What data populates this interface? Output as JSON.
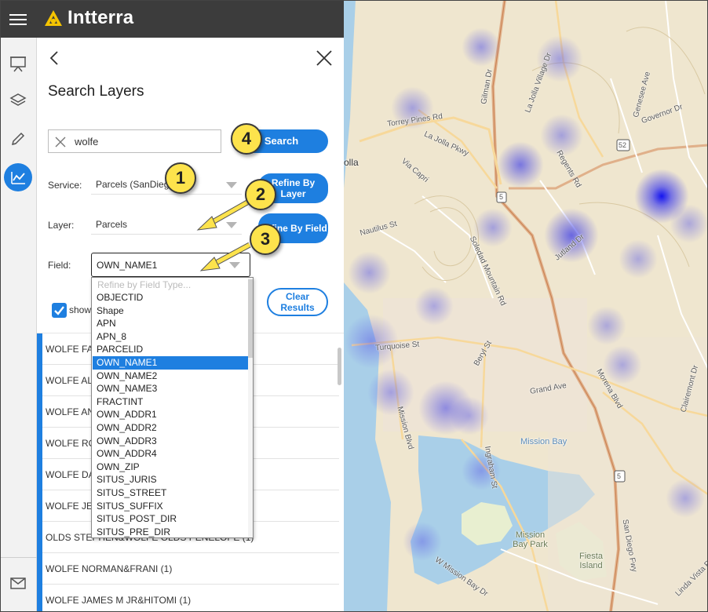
{
  "app": {
    "title": "Intterra"
  },
  "rail": {
    "items": [
      {
        "name": "presentation-icon"
      },
      {
        "name": "layers-icon"
      },
      {
        "name": "pencil-icon"
      },
      {
        "name": "analytics-icon",
        "active": true
      },
      {
        "name": "mail-icon"
      }
    ]
  },
  "panel": {
    "title": "Search Layers",
    "search": {
      "value": "wolfe",
      "button_label": "Search"
    },
    "service": {
      "label": "Service:",
      "value": "Parcels (SanDiego)",
      "refine_label": "Refine By Layer"
    },
    "layer": {
      "label": "Layer:",
      "value": "Parcels",
      "refine_label": "Refine By Field"
    },
    "field": {
      "label": "Field:",
      "value": "OWN_NAME1"
    },
    "show_checkbox": {
      "checked": true,
      "label": "show"
    },
    "clear_label": "Clear Results",
    "results": [
      "WOLFE FA",
      "WOLFE AL                                      (2)",
      "WOLFE AN",
      "WOLFE RO",
      "WOLFE DA",
      "WOLFE JE",
      "OLDS STEPHEN&WOLFE OLDS PENELOPE (1)",
      "WOLFE NORMAN&FRANI (1)",
      "WOLFE JAMES M JR&HITOMI (1)"
    ]
  },
  "dropdown": {
    "filter_placeholder": "Refine by Field Type...",
    "options": [
      "OBJECTID",
      "Shape",
      "APN",
      "APN_8",
      "PARCELID",
      "OWN_NAME1",
      "OWN_NAME2",
      "OWN_NAME3",
      "FRACTINT",
      "OWN_ADDR1",
      "OWN_ADDR2",
      "OWN_ADDR3",
      "OWN_ADDR4",
      "OWN_ZIP",
      "SITUS_JURIS",
      "SITUS_STREET",
      "SITUS_SUFFIX",
      "SITUS_POST_DIR",
      "SITUS_PRE_DIR"
    ],
    "selected": "OWN_NAME1"
  },
  "callouts": [
    "1",
    "2",
    "3",
    "4"
  ],
  "map": {
    "labels": [
      "Torrey Pines Rd",
      "La Jolla Pkwy",
      "Via Capri",
      "Nautilus St",
      "Soledad Mountain Rd",
      "Gilman Dr",
      "La Jolla Village Dr",
      "Regents Rd",
      "Genesee Ave",
      "Governor Dr",
      "Jutland Dr",
      "Turquoise St",
      "Beryl St",
      "Grand Ave",
      "Mission Blvd",
      "Ingraham St",
      "Morena Blvd",
      "Clairemont Dr",
      "W Mission Bay Dr",
      "San Diego Fwy",
      "Linda Vista Rd",
      "olla",
      "5",
      "52"
    ],
    "water_labels": [
      "Mission Bay",
      "Mission Bay Park",
      "Fiesta Island"
    ]
  },
  "colors": {
    "accent": "#1e7fe0",
    "topbar": "#3c3c3c",
    "callout": "#fde34c",
    "logo": "#f5c400"
  }
}
